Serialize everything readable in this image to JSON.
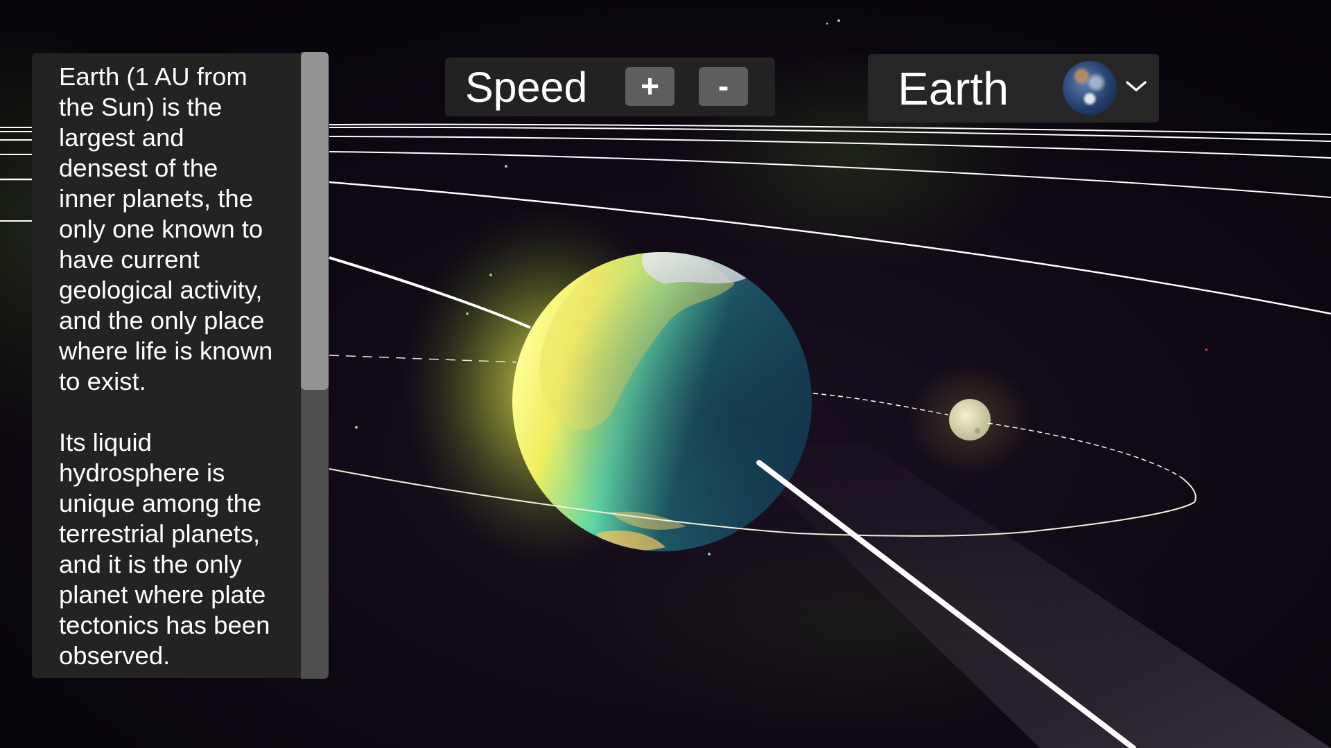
{
  "info_panel": {
    "paragraphs": [
      "Earth (1 AU from\nthe Sun) is the\nlargest and\ndensest of the\ninner planets, the\nonly one known to\nhave current\ngeological activity,\nand the only place\nwhere life is known\nto exist.",
      "Its liquid\nhydrosphere is\nunique among the\nterrestrial planets,\nand it is the only\nplanet where plate\ntectonics has been\nobserved."
    ],
    "scroll_position": 0
  },
  "speed_control": {
    "label": "Speed",
    "increase_label": "+",
    "decrease_label": "-"
  },
  "planet_selector": {
    "selected": "Earth",
    "icon": "earth-globe-icon",
    "chevron_icon": "chevron-down-icon"
  },
  "scene": {
    "focused_body": "Earth",
    "bodies": [
      "Earth",
      "Moon"
    ],
    "colors": {
      "space_background": "#0c0610",
      "orbit_line": "#ffffff",
      "earth_ocean": "#1c4a5c",
      "earth_sunlit": "#f2f06a",
      "moon": "#d9d8b0",
      "panel_bg": "#232323",
      "button_bg": "#5e5e5e"
    }
  }
}
